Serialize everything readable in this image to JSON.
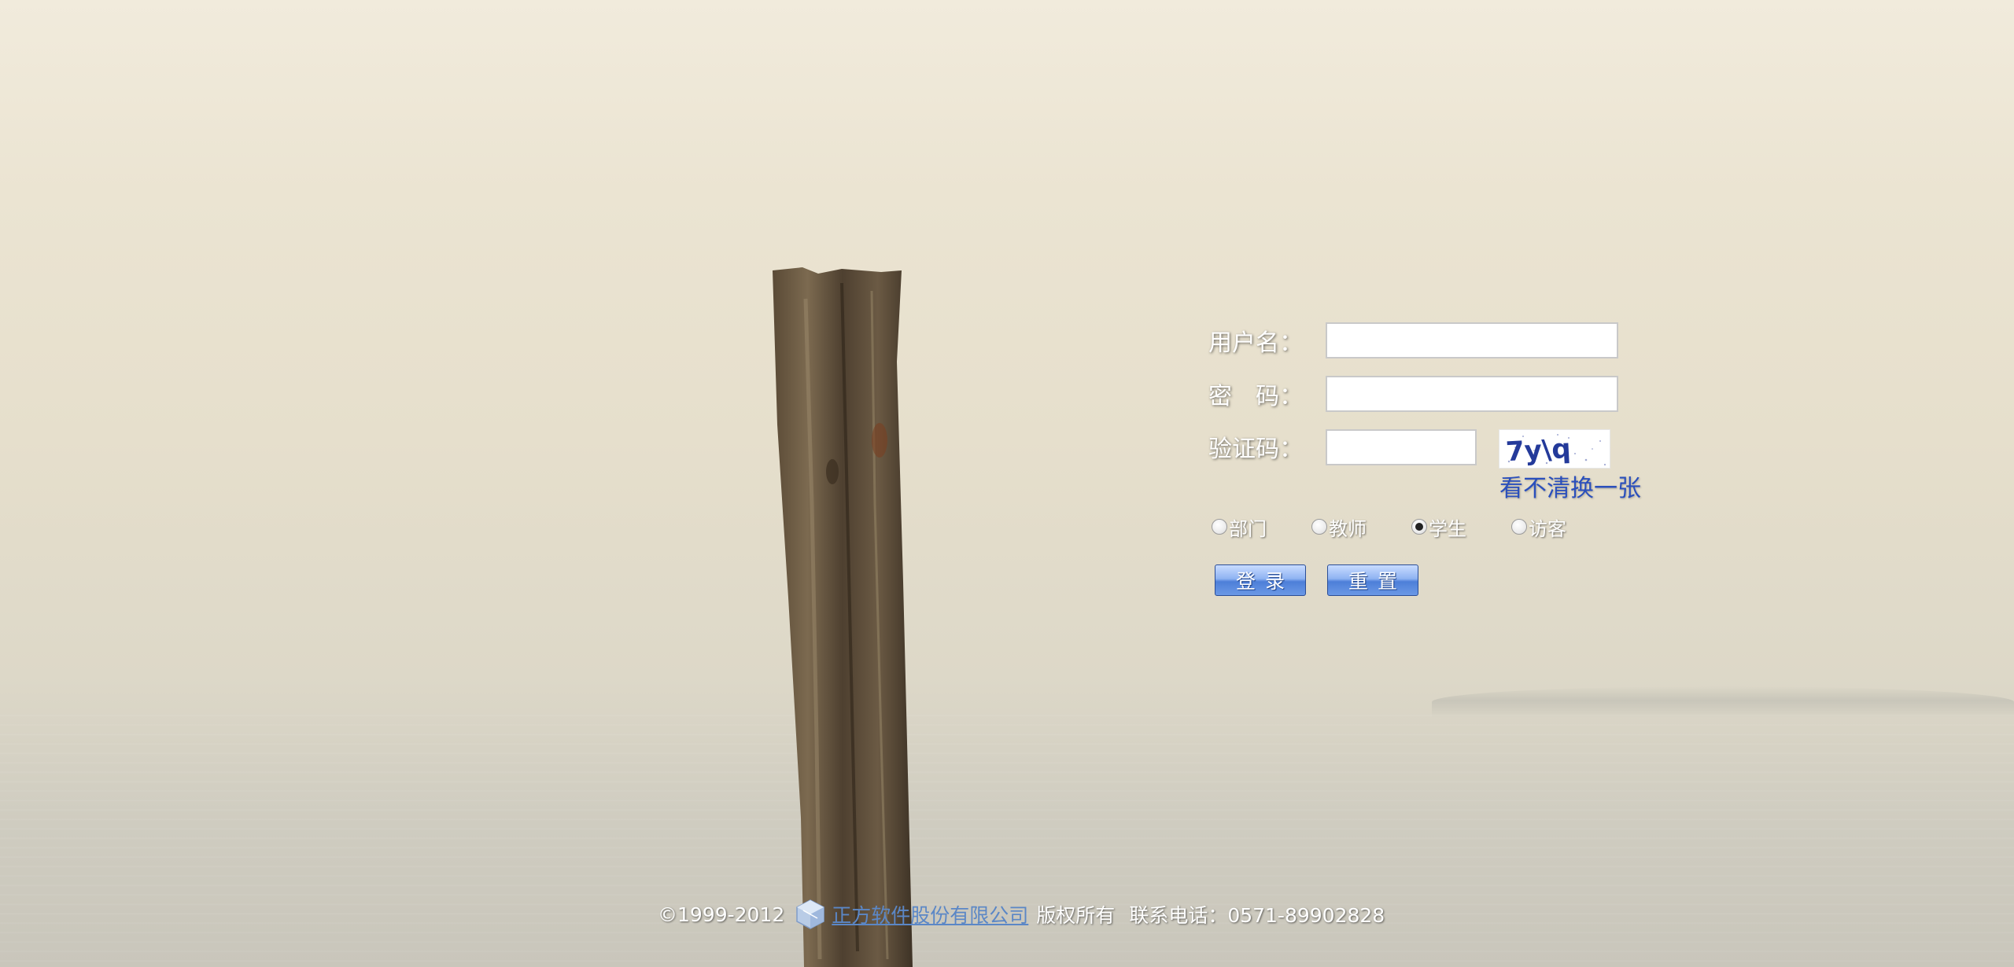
{
  "login_form": {
    "username_label": "用户名：",
    "password_label": "密　码：",
    "captcha_label": "验证码：",
    "username_value": "",
    "password_value": "",
    "captcha_value": "",
    "captcha_image_text": "7y\\q",
    "refresh_captcha_link": "看不清换一张",
    "roles": [
      {
        "label": "部门",
        "selected": false
      },
      {
        "label": "教师",
        "selected": false
      },
      {
        "label": "学生",
        "selected": true
      },
      {
        "label": "访客",
        "selected": false
      }
    ],
    "login_button": "登录",
    "reset_button": "重置"
  },
  "footer": {
    "copyright": "©1999-2012",
    "company": "正方软件股份有限公司",
    "rights": "版权所有",
    "phone": "联系电话：0571-89902828"
  },
  "colors": {
    "link": "#2a4fbc",
    "company": "#5b87c6",
    "button": "#4d7fd8"
  }
}
